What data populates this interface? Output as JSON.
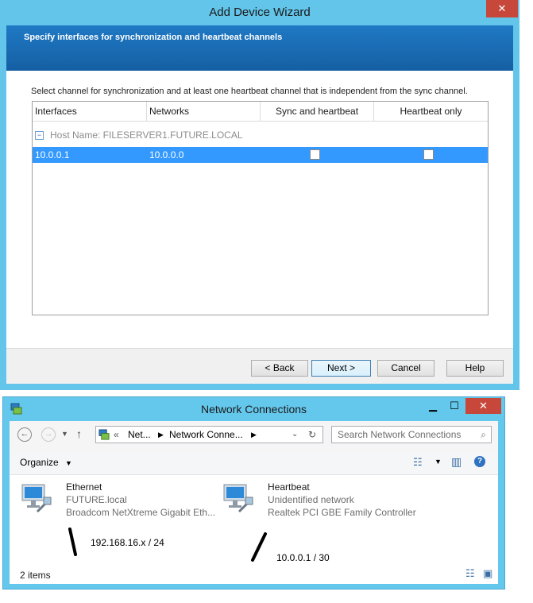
{
  "wizard": {
    "title": "Add Device Wizard",
    "header": "Specify interfaces for synchronization and heartbeat channels",
    "instruction": "Select channel for synchronization and at least one heartbeat channel that is independent from the sync channel.",
    "columns": [
      "Interfaces",
      "Networks",
      "Sync and heartbeat",
      "Heartbeat only"
    ],
    "group_label": "Host Name: FILESERVER1.FUTURE.LOCAL",
    "rows": [
      {
        "interface": "10.0.0.1",
        "network": "10.0.0.0",
        "sync_checked": false,
        "heartbeat_checked": false
      }
    ],
    "buttons": {
      "back": "< Back",
      "next": "Next >",
      "cancel": "Cancel",
      "help": "Help"
    }
  },
  "network": {
    "title": "Network Connections",
    "breadcrumb": [
      "Net...",
      "Network Conne..."
    ],
    "search_placeholder": "Search Network Connections",
    "organize_label": "Organize",
    "items": [
      {
        "name": "Ethernet",
        "status": "FUTURE.local",
        "device": "Broadcom NetXtreme Gigabit Eth..."
      },
      {
        "name": "Heartbeat",
        "status": "Unidentified network",
        "device": "Realtek PCI GBE Family Controller"
      }
    ],
    "annotations": [
      "192.168.16.x / 24",
      "10.0.0.1 / 30"
    ],
    "status_bar": "2 items"
  },
  "colors": {
    "titlebar": "#63c5ea",
    "header": "#1f79c4",
    "selection": "#3399ff",
    "close": "#c7483b"
  }
}
